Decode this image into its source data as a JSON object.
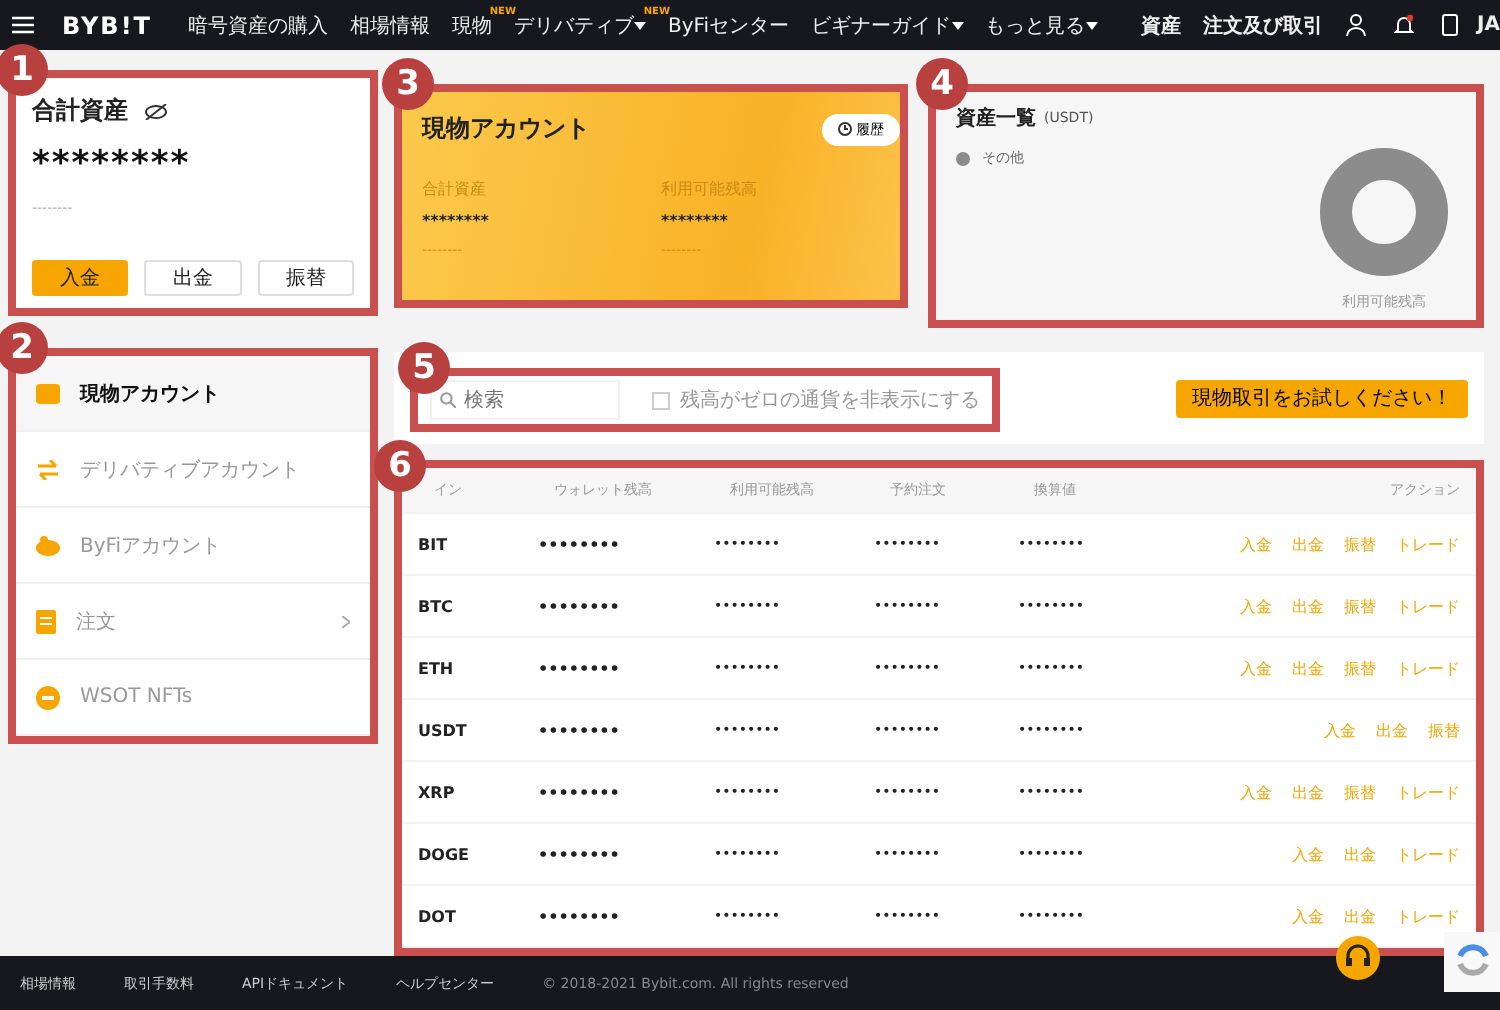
{
  "header": {
    "logo": "BYB!T",
    "nav": [
      {
        "label": "暗号資産の購入",
        "caret": false
      },
      {
        "label": "相場情報",
        "caret": false
      },
      {
        "label": "現物",
        "badge": "NEW",
        "caret": false
      },
      {
        "label": "デリバティブ",
        "badge": "NEW",
        "caret": true
      },
      {
        "label": "ByFiセンター",
        "caret": false
      },
      {
        "label": "ビギナーガイド",
        "caret": true
      },
      {
        "label": "もっと見る",
        "caret": true
      }
    ],
    "right_links": [
      "資産",
      "注文及び取引"
    ],
    "language": "JA"
  },
  "total_assets": {
    "badge": "1",
    "title": "合計資産",
    "amount": "********",
    "sub": "--------",
    "buttons": [
      {
        "label": "入金",
        "primary": true
      },
      {
        "label": "出金",
        "primary": false
      },
      {
        "label": "振替",
        "primary": false
      }
    ]
  },
  "sidebar": {
    "badge": "2",
    "items": [
      {
        "label": "現物アカウント",
        "selected": true,
        "kind": "wallet",
        "chevron": false
      },
      {
        "label": "デリバティブアカウント",
        "selected": false,
        "kind": "swap",
        "chevron": false
      },
      {
        "label": "ByFiアカウント",
        "selected": false,
        "kind": "piggy",
        "chevron": false
      },
      {
        "label": "注文",
        "selected": false,
        "kind": "doc",
        "chevron": true
      },
      {
        "label": "WSOT NFTs",
        "selected": false,
        "kind": "coin",
        "chevron": false
      }
    ]
  },
  "spot_account": {
    "badge": "3",
    "title": "現物アカウント",
    "history_button": "履歴",
    "stats": [
      {
        "label": "合計資産",
        "value": "********",
        "sub": "--------"
      },
      {
        "label": "利用可能残高",
        "value": "********",
        "sub": "--------"
      }
    ]
  },
  "asset_overview": {
    "badge": "4",
    "title": "資産一覧",
    "unit": "(USDT)",
    "legend": [
      {
        "label": "その他",
        "color": "#8c8c8c"
      }
    ],
    "chart_caption": "利用可能残高"
  },
  "toolbar": {
    "badge": "5",
    "search": {
      "placeholder": "検索"
    },
    "hide_zero": {
      "label": "残高がゼロの通貨を非表示にする",
      "checked": false
    },
    "try_button": "現物取引をお試しください！"
  },
  "table": {
    "badge": "6",
    "columns": [
      "イン",
      "ウォレット残高",
      "利用可能残高",
      "予約注文",
      "換算値",
      "アクション"
    ],
    "rows": [
      {
        "coin": "BIT",
        "wallet": "••••••••",
        "available": "••••••••",
        "orders": "••••••••",
        "value": "••••••••",
        "actions": [
          "入金",
          "出金",
          "振替",
          "トレード"
        ]
      },
      {
        "coin": "BTC",
        "wallet": "••••••••",
        "available": "••••••••",
        "orders": "••••••••",
        "value": "••••••••",
        "actions": [
          "入金",
          "出金",
          "振替",
          "トレード"
        ]
      },
      {
        "coin": "ETH",
        "wallet": "••••••••",
        "available": "••••••••",
        "orders": "••••••••",
        "value": "••••••••",
        "actions": [
          "入金",
          "出金",
          "振替",
          "トレード"
        ]
      },
      {
        "coin": "USDT",
        "wallet": "••••••••",
        "available": "••••••••",
        "orders": "••••••••",
        "value": "••••••••",
        "actions": [
          "入金",
          "出金",
          "振替"
        ]
      },
      {
        "coin": "XRP",
        "wallet": "••••••••",
        "available": "••••••••",
        "orders": "••••••••",
        "value": "••••••••",
        "actions": [
          "入金",
          "出金",
          "振替",
          "トレード"
        ]
      },
      {
        "coin": "DOGE",
        "wallet": "••••••••",
        "available": "••••••••",
        "orders": "••••••••",
        "value": "••••••••",
        "actions": [
          "入金",
          "出金",
          "トレード"
        ]
      },
      {
        "coin": "DOT",
        "wallet": "••••••••",
        "available": "••••••••",
        "orders": "••••••••",
        "value": "••••••••",
        "actions": [
          "入金",
          "出金",
          "トレード"
        ]
      }
    ]
  },
  "footer": {
    "links": [
      "相場情報",
      "取引手数料",
      "APIドキュメント",
      "ヘルプセンター"
    ],
    "copyright": "© 2018-2021 Bybit.com. All rights reserved"
  }
}
